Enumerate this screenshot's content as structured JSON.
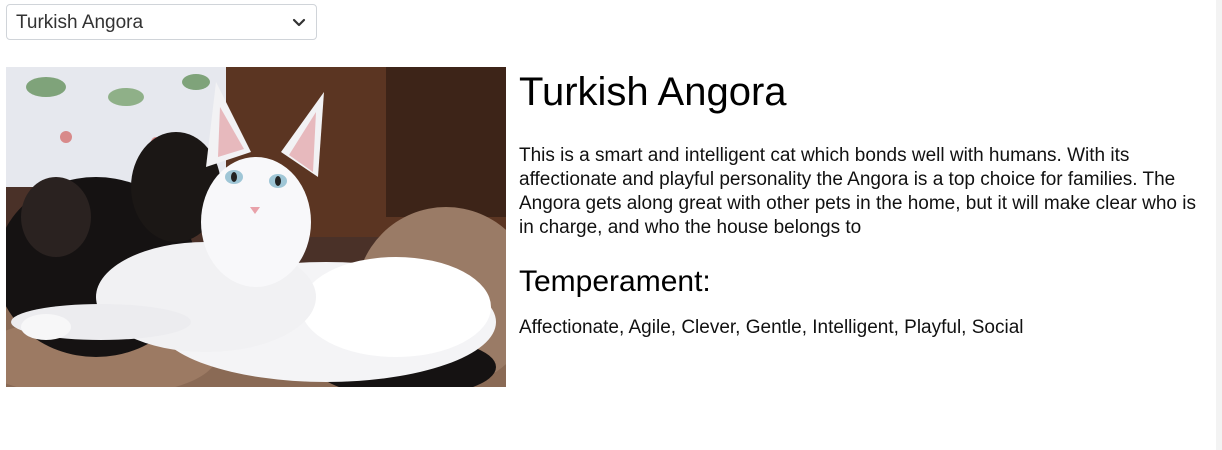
{
  "breed_select": {
    "selected": "Turkish Angora",
    "icon": "chevron-down-icon"
  },
  "breed": {
    "image_alt": "cat photo",
    "name": "Turkish Angora",
    "description": "This is a smart and intelligent cat which bonds well with humans. With its affectionate and playful personality the Angora is a top choice for families. The Angora gets along great with other pets in the home, but it will make clear who is in charge, and who the house belongs to",
    "temperament_heading": "Temperament:",
    "temperament": "Affectionate, Agile, Clever, Gentle, Intelligent, Playful, Social"
  }
}
